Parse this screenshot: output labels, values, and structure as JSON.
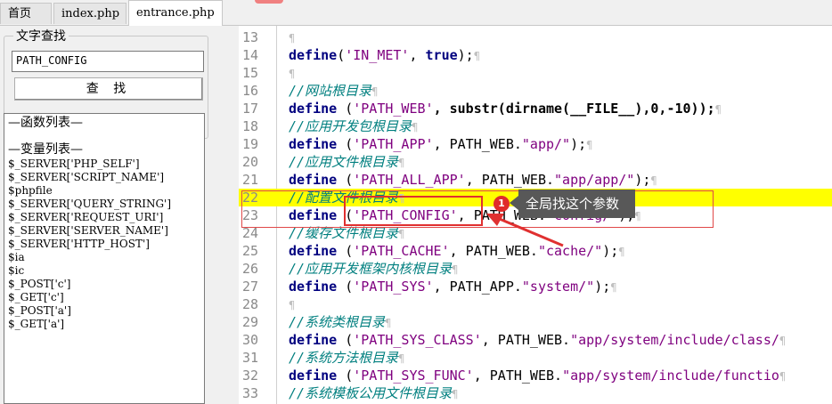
{
  "tabs": [
    {
      "label": "首页"
    },
    {
      "label": "index.php"
    },
    {
      "label": "entrance.php",
      "active": true
    }
  ],
  "search": {
    "group_title": "文字查找",
    "value": "PATH_CONFIG",
    "button_label": "查 找"
  },
  "sidebar_list": {
    "functions_header": "—函数列表—",
    "variables_header": "—变量列表—",
    "variables": [
      "$_SERVER['PHP_SELF']",
      "$_SERVER['SCRIPT_NAME']",
      "$phpfile",
      "$_SERVER['QUERY_STRING']",
      "$_SERVER['REQUEST_URI']",
      "$_SERVER['SERVER_NAME']",
      "$_SERVER['HTTP_HOST']",
      "$ia",
      "$ic",
      "$_POST['c']",
      "$_GET['c']",
      "$_POST['a']",
      "$_GET['a']"
    ]
  },
  "editor": {
    "highlight_line": 22,
    "lines": [
      {
        "n": "13",
        "kind": "blank"
      },
      {
        "n": "14",
        "kind": "define_bool",
        "fn": "define",
        "p1": "(",
        "arg": "'IN_MET'",
        "mid": ", ",
        "val": "true",
        "end": ");"
      },
      {
        "n": "15",
        "kind": "blank"
      },
      {
        "n": "16",
        "kind": "comment",
        "text": "//网站根目录"
      },
      {
        "n": "17",
        "kind": "code",
        "fn": "define",
        "p1": " (",
        "arg": "'PATH_WEB'",
        "rest": ", substr(dirname(__FILE__),0,-10));"
      },
      {
        "n": "18",
        "kind": "comment",
        "text": "//应用开发包根目录"
      },
      {
        "n": "19",
        "kind": "code2",
        "fn": "define",
        "p1": " (",
        "arg": "'PATH_APP'",
        "mid": ", PATH_WEB.",
        "str2": "\"app/\"",
        "end": ");"
      },
      {
        "n": "20",
        "kind": "comment",
        "text": "//应用文件根目录"
      },
      {
        "n": "21",
        "kind": "code2",
        "fn": "define",
        "p1": " (",
        "arg": "'PATH_ALL_APP'",
        "mid": ", PATH_WEB.",
        "str2": "\"app/app/\"",
        "end": ");"
      },
      {
        "n": "22",
        "kind": "comment",
        "text": "//配置文件根目录"
      },
      {
        "n": "23",
        "kind": "code2",
        "fn": "define",
        "p1": " (",
        "arg": "'PATH_CONFIG'",
        "mid": ", PATH_WEB.",
        "str2": "\"config/\"",
        "end": ");"
      },
      {
        "n": "24",
        "kind": "comment",
        "text": "//缓存文件根目录"
      },
      {
        "n": "25",
        "kind": "code2",
        "fn": "define",
        "p1": " (",
        "arg": "'PATH_CACHE'",
        "mid": ", PATH_WEB.",
        "str2": "\"cache/\"",
        "end": ");"
      },
      {
        "n": "26",
        "kind": "comment",
        "text": "//应用开发框架内核根目录"
      },
      {
        "n": "27",
        "kind": "code2",
        "fn": "define",
        "p1": " (",
        "arg": "'PATH_SYS'",
        "mid": ", PATH_APP.",
        "str2": "\"system/\"",
        "end": ");"
      },
      {
        "n": "28",
        "kind": "blank"
      },
      {
        "n": "29",
        "kind": "comment",
        "text": "//系统类根目录"
      },
      {
        "n": "30",
        "kind": "code2",
        "fn": "define",
        "p1": " (",
        "arg": "'PATH_SYS_CLASS'",
        "mid": ", PATH_WEB.",
        "str2": "\"app/system/include/class/",
        "end": ""
      },
      {
        "n": "31",
        "kind": "comment",
        "text": "//系统方法根目录"
      },
      {
        "n": "32",
        "kind": "code2",
        "fn": "define",
        "p1": " (",
        "arg": "'PATH_SYS_FUNC'",
        "mid": ", PATH_WEB.",
        "str2": "\"app/system/include/functio",
        "end": ""
      },
      {
        "n": "33",
        "kind": "comment",
        "text": "//系统模板公用文件根目录"
      }
    ],
    "pilcrow": "¶"
  },
  "annotation": {
    "badge": "1",
    "text": "全局找这个参数"
  }
}
